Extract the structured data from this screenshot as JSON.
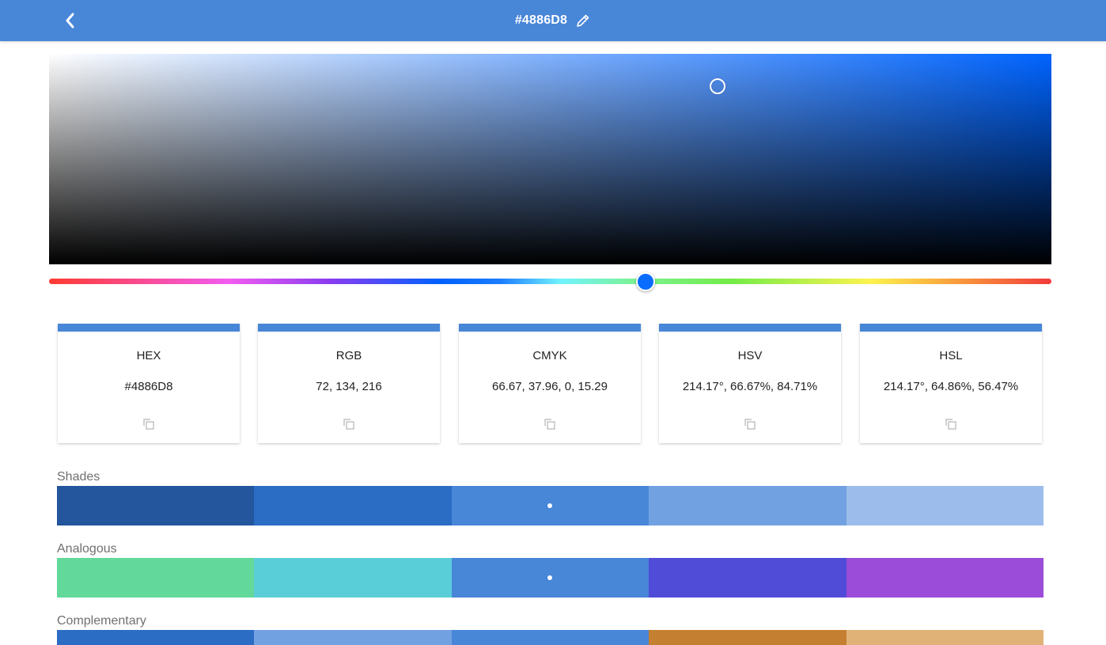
{
  "header": {
    "title": "#4886D8",
    "back_icon": "chevron-left-icon",
    "edit_icon": "pencil-icon",
    "color": "#4886D8"
  },
  "picker": {
    "hue": 214.17,
    "saturation": 0.6667,
    "value": 0.8471,
    "hue_color": "#0064ff"
  },
  "formats": [
    {
      "label": "HEX",
      "value": "#4886D8"
    },
    {
      "label": "RGB",
      "value": "72, 134, 216"
    },
    {
      "label": "CMYK",
      "value": "66.67, 37.96, 0, 15.29"
    },
    {
      "label": "HSV",
      "value": "214.17°, 66.67%, 84.71%"
    },
    {
      "label": "HSL",
      "value": "214.17°, 64.86%, 56.47%"
    }
  ],
  "copy_icon": "copy-icon",
  "shades": {
    "label": "Shades",
    "colors": [
      "#23569D",
      "#2B6CC4",
      "#4886D8",
      "#72A1E2",
      "#9CBDEB"
    ],
    "selected": 2
  },
  "analogous": {
    "label": "Analogous",
    "colors": [
      "#62D89A",
      "#5ACED8",
      "#4886D8",
      "#514CD8",
      "#9B4CD8"
    ],
    "selected": 2
  },
  "complementary": {
    "label": "Complementary",
    "colors": [
      "#2B6CC4",
      "#72A1E2",
      "#4886D8",
      "#C57F31",
      "#E1B277"
    ],
    "selected": null
  }
}
